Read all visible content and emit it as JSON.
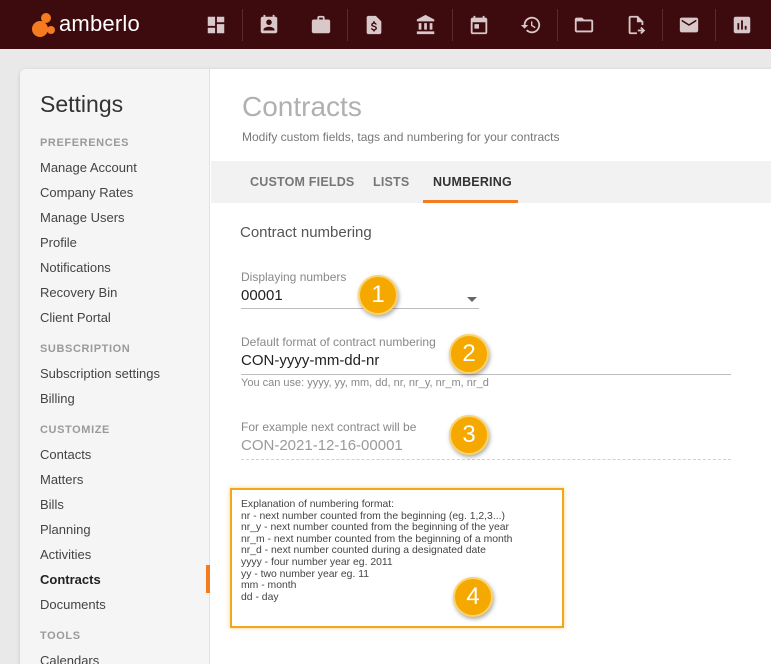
{
  "app": {
    "logo_text": "amberlo"
  },
  "topnav": [
    {
      "icon": "dashboard-icon"
    },
    {
      "icon": "contacts-icon"
    },
    {
      "icon": "matters-icon"
    },
    {
      "icon": "bills-icon"
    },
    {
      "icon": "bank-icon"
    },
    {
      "icon": "calendar-icon"
    },
    {
      "icon": "timer-icon"
    },
    {
      "icon": "folder-icon"
    },
    {
      "icon": "contract-icon"
    },
    {
      "icon": "mail-icon"
    },
    {
      "icon": "reports-icon"
    }
  ],
  "sidebar": {
    "title": "Settings",
    "sections": [
      {
        "label": "PREFERENCES",
        "items": [
          "Manage Account",
          "Company Rates",
          "Manage Users",
          "Profile",
          "Notifications",
          "Recovery Bin",
          "Client Portal"
        ]
      },
      {
        "label": "SUBSCRIPTION",
        "items": [
          "Subscription settings",
          "Billing"
        ]
      },
      {
        "label": "CUSTOMIZE",
        "items": [
          "Contacts",
          "Matters",
          "Bills",
          "Planning",
          "Activities",
          "Contracts",
          "Documents"
        ]
      },
      {
        "label": "TOOLS",
        "items": [
          "Calendars"
        ]
      }
    ],
    "active_item": "Contracts"
  },
  "main": {
    "title": "Contracts",
    "subtitle": "Modify custom fields, tags and numbering for your contracts",
    "tabs": [
      "CUSTOM FIELDS",
      "LISTS",
      "NUMBERING"
    ],
    "active_tab": "NUMBERING",
    "section_title": "Contract numbering",
    "displaying": {
      "label": "Displaying numbers",
      "value": "00001"
    },
    "format": {
      "label": "Default format of contract numbering",
      "value": "CON-yyyy-mm-dd-nr",
      "hint": "You can use: yyyy, yy, mm, dd, nr, nr_y, nr_m, nr_d"
    },
    "example": {
      "label": "For example next contract will be",
      "value": "CON-2021-12-16-00001"
    },
    "explanation": [
      "Explanation of numbering format:",
      "nr - next number counted from the beginning (eg. 1,2,3...)",
      "nr_y - next number counted from the beginning of the year",
      "nr_m - next number counted from the beginning of a month",
      "nr_d - next number counted during a designated date",
      "yyyy - four number year eg. 2011",
      "yy - two number year eg. 11",
      "mm - month",
      "dd - day"
    ]
  },
  "badges": [
    "1",
    "2",
    "3",
    "4"
  ],
  "colors": {
    "topbar": "#3d0a0e",
    "accent": "#f47b20",
    "badge": "#f5a800"
  }
}
